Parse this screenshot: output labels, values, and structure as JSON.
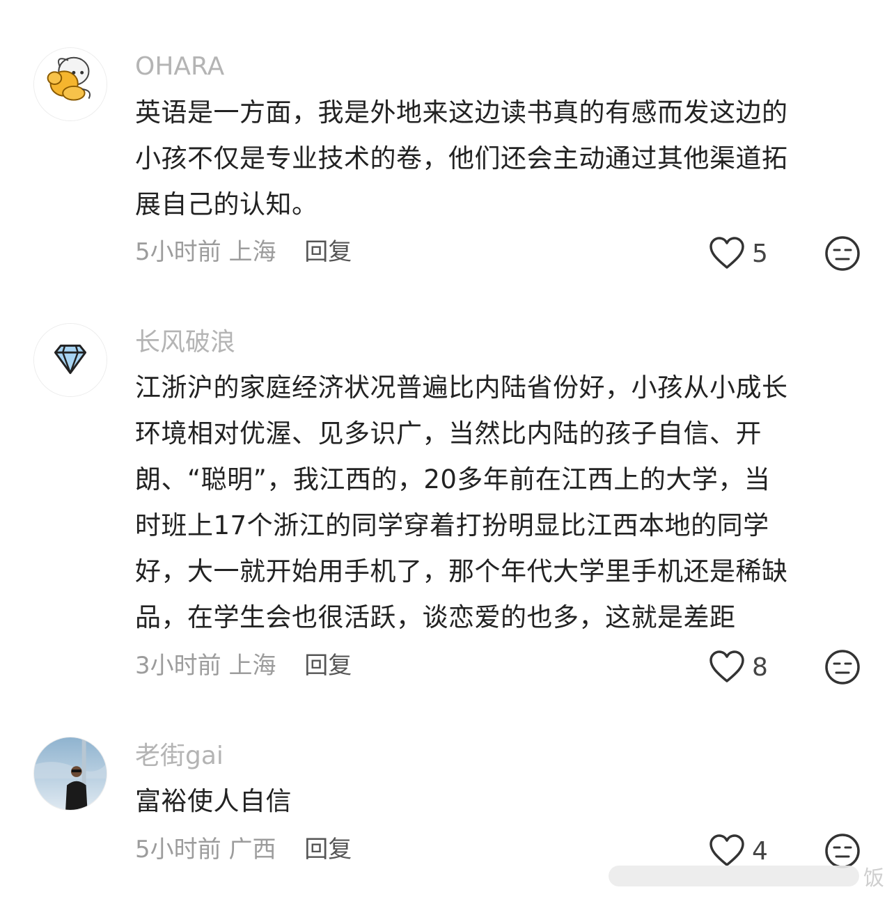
{
  "comments": [
    {
      "username": "OHARA",
      "lines": [
        "英语是一方面，我是外地来这边读书真的有感而发这边的",
        "小孩不仅是专业技术的卷，他们还会主动通过其他渠道拓",
        "展自己的认知。"
      ],
      "time": "5小时前",
      "location": "上海",
      "reply_label": "回复",
      "likes": "5",
      "avatar_icon": "cartoon-cat-avatar"
    },
    {
      "username": "长风破浪",
      "lines": [
        "江浙沪的家庭经济状况普遍比内陆省份好，小孩从小成长",
        "环境相对优渥、见多识广，当然比内陆的孩子自信、开",
        "朗、“聪明”，我江西的，20多年前在江西上的大学，当",
        "时班上17个浙江的同学穿着打扮明显比江西本地的同学",
        "好，大一就开始用手机了，那个年代大学里手机还是稀缺",
        "品，在学生会也很活跃，谈恋爱的也多，这就是差距"
      ],
      "time": "3小时前",
      "location": "上海",
      "reply_label": "回复",
      "likes": "8",
      "avatar_icon": "diamond-avatar"
    },
    {
      "username": "老街gai",
      "lines": [
        "富裕使人自信"
      ],
      "time": "5小时前",
      "location": "广西",
      "reply_label": "回复",
      "likes": "4",
      "avatar_icon": "photo-person-avatar"
    }
  ],
  "watermark": {
    "text": "饭"
  },
  "colors": {
    "username": "#b4b4b4",
    "body": "#222222",
    "meta": "#9c9c9c",
    "icon": "#333333"
  }
}
